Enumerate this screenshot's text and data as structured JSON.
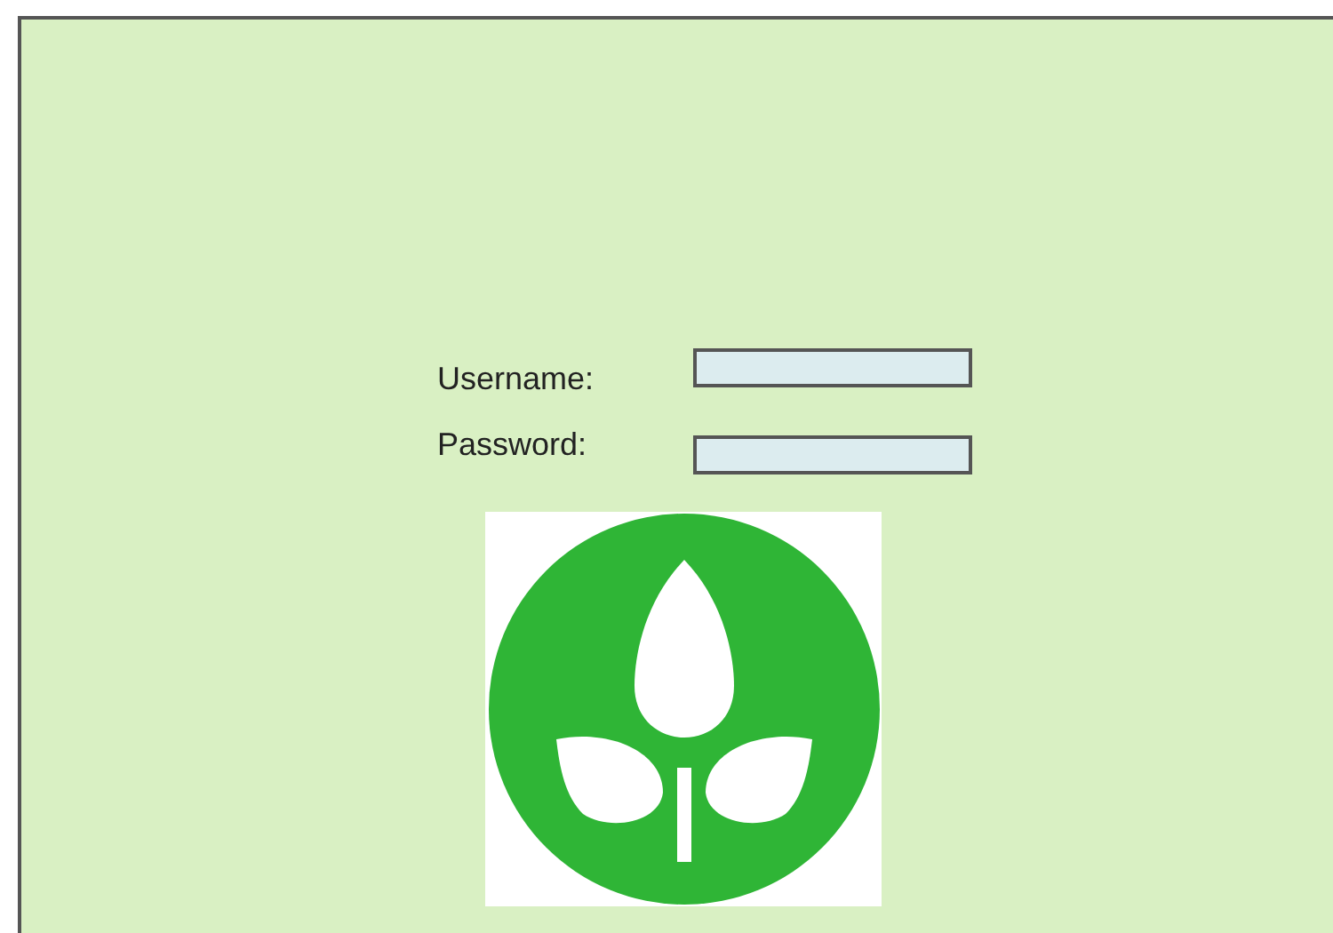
{
  "login_form": {
    "fields": [
      {
        "label": "Username:"
      },
      {
        "label": "Password:"
      }
    ]
  }
}
